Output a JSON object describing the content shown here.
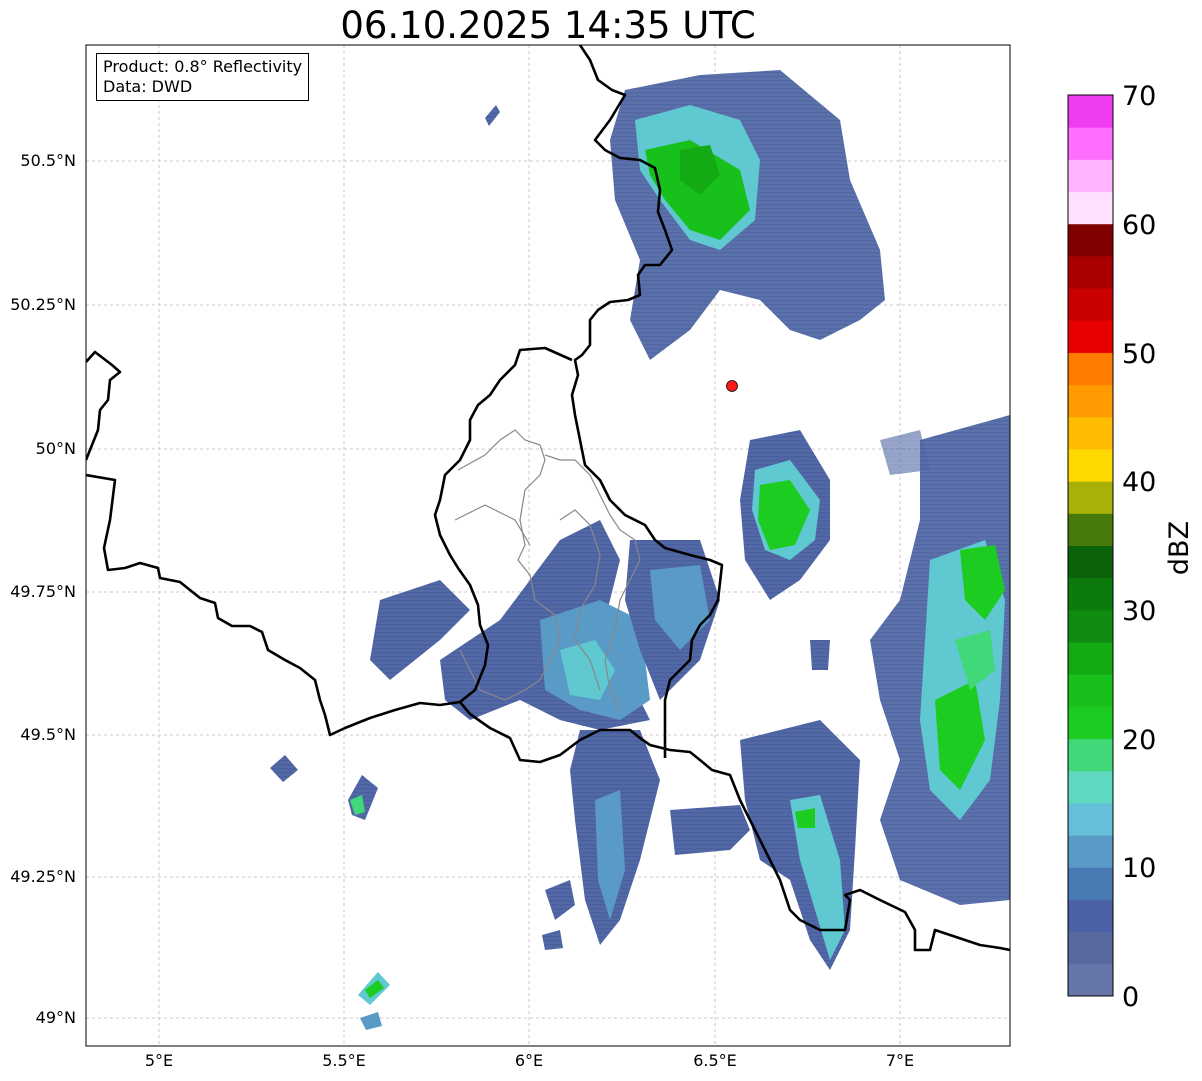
{
  "title": "06.10.2025 14:35 UTC",
  "info_box": {
    "product": "Product: 0.8° Reflectivity",
    "data": "Data: DWD"
  },
  "axes": {
    "lat_ticks": [
      "50.5°N",
      "50.25°N",
      "50°N",
      "49.75°N",
      "49.5°N",
      "49.25°N",
      "49°N"
    ],
    "lon_ticks": [
      "5°E",
      "5.5°E",
      "6°E",
      "6.5°E",
      "7°E"
    ]
  },
  "radar_site": {
    "lon": 6.55,
    "lat": 50.11,
    "color": "#ff1a1a"
  },
  "colorbar": {
    "unit": "dBZ",
    "ticks": [
      "0",
      "10",
      "20",
      "30",
      "40",
      "50",
      "60",
      "70"
    ],
    "colors": [
      "#6676a8",
      "#5869a0",
      "#4c61a6",
      "#4a7ab4",
      "#5a9ac6",
      "#66bfd8",
      "#5fd8c0",
      "#40d878",
      "#1ccc20",
      "#18c01c",
      "#14aa14",
      "#108c10",
      "#0d7a0d",
      "#0a620a",
      "#477a0a",
      "#a8b00a",
      "#ffd800",
      "#ffbb00",
      "#ff9a00",
      "#ff7c00",
      "#e80000",
      "#c80000",
      "#a80000",
      "#800000",
      "#ffe0ff",
      "#ffb4ff",
      "#ff6eff",
      "#f03cf0"
    ]
  }
}
